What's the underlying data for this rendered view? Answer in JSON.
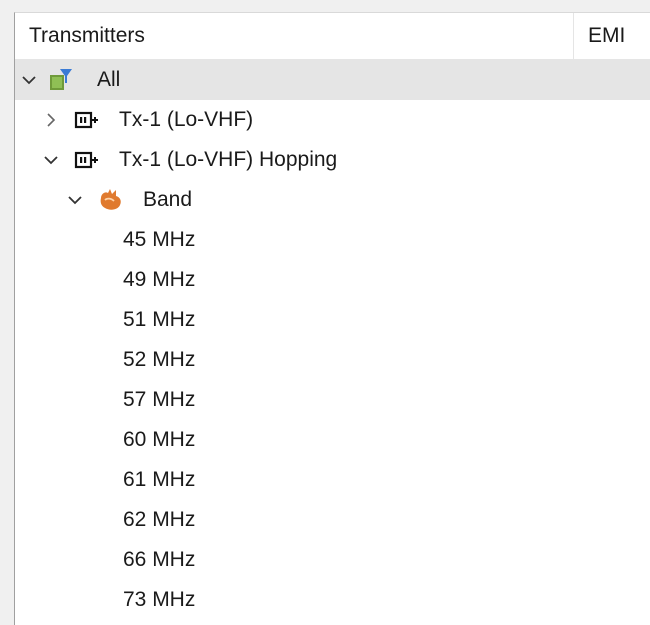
{
  "columns": {
    "transmitters": "Transmitters",
    "emi": "EMI"
  },
  "tree": {
    "all": {
      "label": "All",
      "icon": "filter-folder-icon",
      "expanded": true
    },
    "tx1": {
      "label": "Tx-1 (Lo-VHF)",
      "icon": "radio-transmitter-icon",
      "expanded": false
    },
    "tx1_hopping": {
      "label": "Tx-1 (Lo-VHF) Hopping",
      "icon": "radio-transmitter-icon",
      "expanded": true
    },
    "band": {
      "label": "Band",
      "icon": "band-icon",
      "expanded": true
    },
    "frequencies": [
      "45 MHz",
      "49 MHz",
      "51 MHz",
      "52 MHz",
      "57 MHz",
      "60 MHz",
      "61 MHz",
      "62 MHz",
      "66 MHz",
      "73 MHz"
    ]
  },
  "colors": {
    "selected_row": "#e5e5e5",
    "band_icon": "#e07a2e",
    "folder_icon": "#6f9a3a",
    "filter_icon": "#3a7bd5"
  }
}
